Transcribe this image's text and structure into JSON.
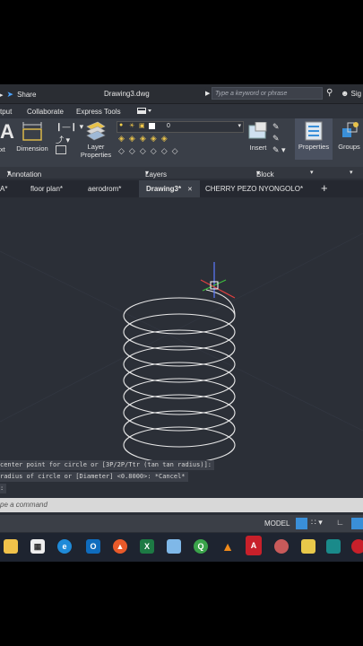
{
  "titlebar": {
    "share_label": "Share",
    "document": "Drawing3.dwg",
    "search_placeholder": "Type a keyword or phrase",
    "user_label": "Sig"
  },
  "menu": {
    "items": [
      "tput",
      "Collaborate",
      "Express Tools"
    ]
  },
  "ribbon": {
    "dimension_label": "Dimension",
    "text_label": "xt",
    "layer_properties_line1": "Layer",
    "layer_properties_line2": "Properties",
    "layer_value": "0",
    "insert_label": "Insert",
    "properties_label": "Properties",
    "groups_label": "Groups",
    "panels": {
      "annotation": "Annotation",
      "layers": "Layers",
      "block": "Block"
    }
  },
  "filetabs": {
    "items": [
      "A*",
      "floor plan*",
      "aerodrom*",
      "Drawing3*",
      "CHERRY PEZO NYONGOLO*"
    ],
    "active_index": 3,
    "close_symbol": "✕",
    "add_symbol": "+"
  },
  "command": {
    "history": [
      "center point for circle or [3P/2P/Ttr (tan tan radius)]:",
      "radius of circle or [Diameter] <0.8000>: *Cancel*",
      ":"
    ],
    "prompt_placeholder": "pe a command"
  },
  "status": {
    "model_label": "MODEL"
  },
  "colors": {
    "canvas_bg": "#2b2f37",
    "ribbon_bg": "#3a3f48",
    "accent_blue": "#3a8fd8",
    "ucs_red": "#e04040",
    "ucs_green": "#3fbf3f",
    "ucs_blue": "#5b7bff"
  },
  "taskbar": {
    "icons": [
      "file-explorer-icon",
      "store-icon",
      "edge-icon",
      "outlook-icon",
      "brave-icon",
      "excel-icon",
      "app-icon",
      "qgis-icon",
      "vlc-icon",
      "autocad-icon",
      "app2-icon",
      "app3-icon",
      "app4-icon",
      "app5-icon"
    ]
  }
}
